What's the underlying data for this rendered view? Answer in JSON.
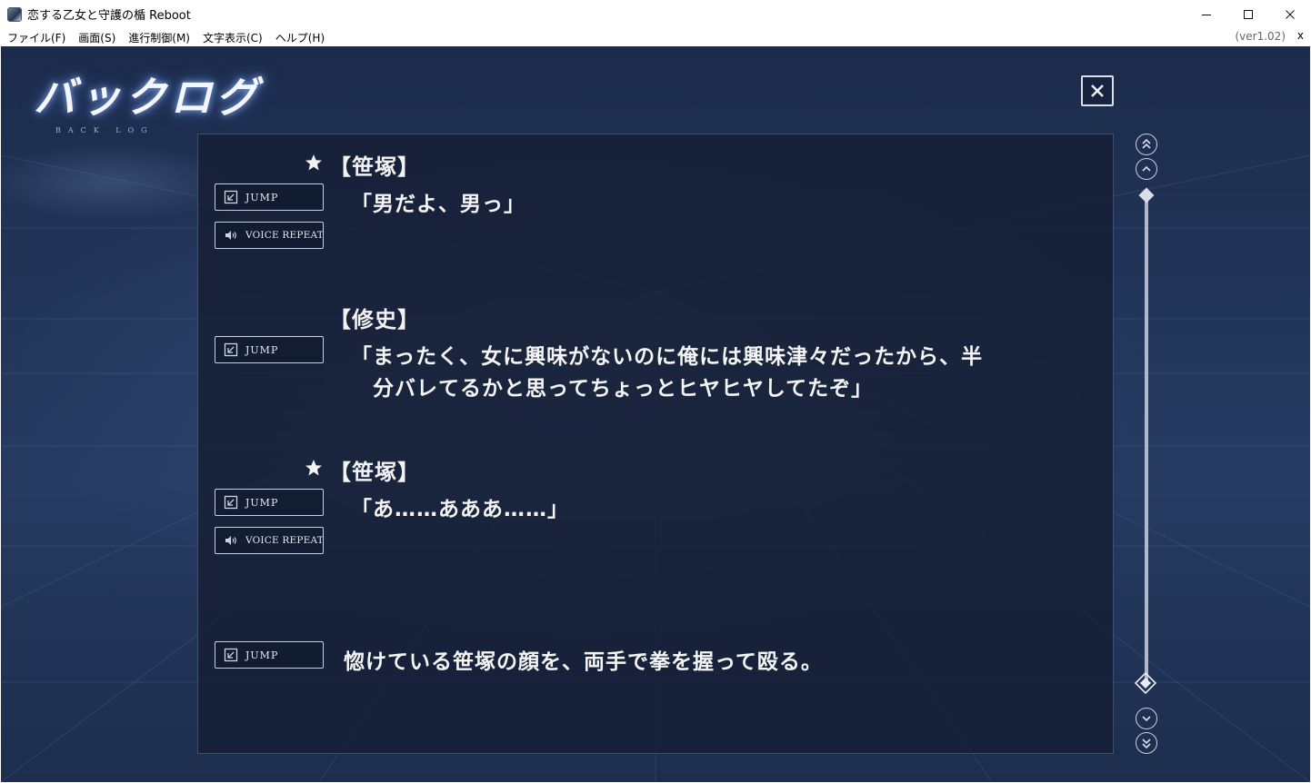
{
  "window": {
    "title": "恋する乙女と守護の楯 Reboot",
    "minimize": "minimize",
    "maximize": "maximize",
    "close": "close"
  },
  "menu": {
    "items": [
      "ファイル(F)",
      "画面(S)",
      "進行制御(M)",
      "文字表示(C)",
      "ヘルプ(H)"
    ],
    "version": "(ver1.02)",
    "close": "x"
  },
  "header": {
    "logo": "バックログ",
    "logo_sub": "BACK LOG"
  },
  "buttons": {
    "jump": "JUMP",
    "voice_repeat": "VOICE REPEAT"
  },
  "entries": [
    {
      "speaker": "【笹塚】",
      "starred": true,
      "voice": true,
      "lines": [
        "「男だよ、男っ」"
      ]
    },
    {
      "speaker": "【修史】",
      "starred": false,
      "voice": false,
      "lines": [
        "「まったく、女に興味がないのに俺には興味津々だったから、半",
        "　分バレてるかと思ってちょっとヒヤヒヤしてたぞ」"
      ]
    },
    {
      "speaker": "【笹塚】",
      "starred": true,
      "voice": true,
      "lines": [
        "「あ……あああ……」"
      ]
    },
    {
      "speaker": "",
      "starred": false,
      "voice": false,
      "lines": [
        "惚けている笹塚の顔を、両手で拳を握って殴る。"
      ]
    }
  ],
  "scroll": {
    "position": 1.0
  }
}
